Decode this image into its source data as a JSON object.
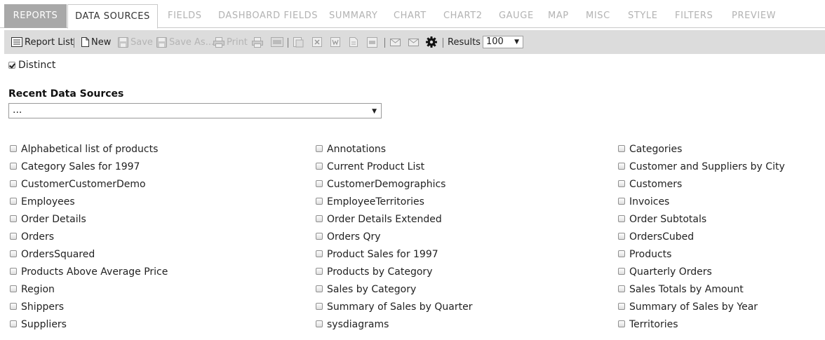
{
  "tabs": [
    {
      "label": "REPORTS",
      "state": "reports"
    },
    {
      "label": "DATA SOURCES",
      "state": "active"
    },
    {
      "label": "FIELDS"
    },
    {
      "label": "DASHBOARD FIELDS"
    },
    {
      "label": "SUMMARY"
    },
    {
      "label": "CHART"
    },
    {
      "label": "CHART2"
    },
    {
      "label": "GAUGE"
    },
    {
      "label": "MAP"
    },
    {
      "label": "MISC"
    },
    {
      "label": "STYLE"
    },
    {
      "label": "FILTERS"
    },
    {
      "label": "PREVIEW"
    }
  ],
  "toolbar": {
    "report_list": "Report List",
    "new": "New",
    "save": "Save",
    "save_as": "Save As...",
    "print": "Print",
    "results_label": "Results",
    "results_value": "100"
  },
  "distinct": {
    "label": "Distinct",
    "checked": true
  },
  "recent": {
    "title": "Recent Data Sources",
    "value": "..."
  },
  "data_sources": {
    "col1": [
      "Alphabetical list of products",
      "Category Sales for 1997",
      "CustomerCustomerDemo",
      "Employees",
      "Order Details",
      "Orders",
      "OrdersSquared",
      "Products Above Average Price",
      "Region",
      "Shippers",
      "Suppliers"
    ],
    "col2": [
      "Annotations",
      "Current Product List",
      "CustomerDemographics",
      "EmployeeTerritories",
      "Order Details Extended",
      "Orders Qry",
      "Product Sales for 1997",
      "Products by Category",
      "Sales by Category",
      "Summary of Sales by Quarter",
      "sysdiagrams"
    ],
    "col3": [
      "Categories",
      "Customer and Suppliers by City",
      "Customers",
      "Invoices",
      "Order Subtotals",
      "OrdersCubed",
      "Products",
      "Quarterly Orders",
      "Sales Totals by Amount",
      "Summary of Sales by Year",
      "Territories"
    ]
  }
}
